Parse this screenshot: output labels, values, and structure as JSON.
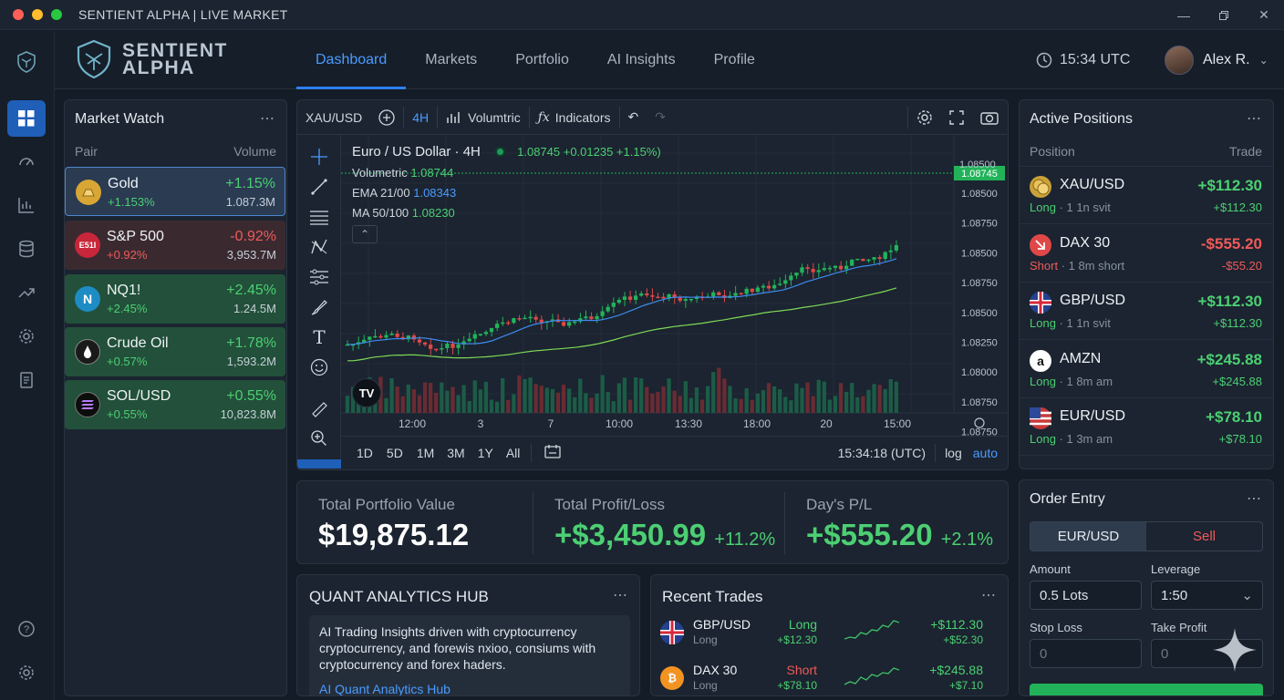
{
  "window": {
    "title": "SENTIENT ALPHA | LIVE MARKET"
  },
  "brand": {
    "line1": "SENTIENT",
    "line2": "ALPHA"
  },
  "nav": {
    "tabs": [
      "Dashboard",
      "Markets",
      "Portfolio",
      "AI Insights",
      "Profile"
    ],
    "active": "Dashboard"
  },
  "header": {
    "time": "15:34 UTC",
    "user": "Alex R."
  },
  "sidebar": {
    "icons": [
      "dashboard-icon",
      "speedometer-icon",
      "chart-bars-icon",
      "database-icon",
      "trend-icon",
      "gear-icon",
      "report-icon",
      "help-icon",
      "settings-icon"
    ]
  },
  "market_watch": {
    "title": "Market Watch",
    "col_pair": "Pair",
    "col_volume": "Volume",
    "rows": [
      {
        "name": "Gold",
        "sub": "+1.153%",
        "pct": "+1.15%",
        "vol": "1.087.3M",
        "icon": "gold-bar-icon",
        "trend": "up"
      },
      {
        "name": "S&P 500",
        "sub": "+0.92%",
        "pct": "-0.92%",
        "vol": "3,953.7M",
        "icon_text": "E51I",
        "trend": "down"
      },
      {
        "name": "NQ1!",
        "sub": "+2.45%",
        "pct": "+2.45%",
        "vol": "1.24.5M",
        "icon_text": "N",
        "trend": "up"
      },
      {
        "name": "Crude Oil",
        "sub": "+0.57%",
        "pct": "+1.78%",
        "vol": "1,593.2M",
        "icon": "oil-drop-icon",
        "trend": "up"
      },
      {
        "name": "SOL/USD",
        "sub": "+0.55%",
        "pct": "+0.55%",
        "vol": "10,823.8M",
        "icon": "solana-icon",
        "trend": "up"
      }
    ]
  },
  "chart_toolbar": {
    "symbol": "XAU/USD",
    "interval": "4H",
    "chart_style": "Volumtric",
    "indicators": "Indicators"
  },
  "chart_legend": {
    "title": "Euro / US Dollar · 4H",
    "quote": "1.08745 +0.01235 +1.15%)",
    "volumetric_label": "Volumetric",
    "volumetric_val": "1.08744",
    "ema_label": "EMA 21/00",
    "ema_val": "1.08343",
    "ma_label": "MA 50/100",
    "ma_val": "1.08230"
  },
  "chart_bottom": {
    "ranges": [
      "1D",
      "5D",
      "1M",
      "3M",
      "1Y",
      "All"
    ],
    "time": "15:34:18 (UTC)",
    "log": "log",
    "auto": "auto"
  },
  "chart_data": {
    "type": "candlestick",
    "price_axis": [
      "1.08500",
      "1.08750",
      "1.08500",
      "1.08750",
      "1.08500",
      "1.08250",
      "1.08000",
      "1.08750",
      "1.08750"
    ],
    "price_axis_top": "1.08500",
    "last_price": "1.08745",
    "x_labels": [
      "12:00",
      "3",
      "7",
      "10:00",
      "13:30",
      "18:00",
      "20",
      "15:00"
    ],
    "series": [
      {
        "name": "EMA 21/00",
        "color": "#3d8bf0"
      },
      {
        "name": "MA 50/100",
        "color": "#7fd957"
      }
    ],
    "up_color": "#22b35a",
    "down_color": "#e04848"
  },
  "stats": {
    "total_label": "Total Portfolio Value",
    "total_value": "$19,875.12",
    "pl_label": "Total Profit/Loss",
    "pl_value": "+$3,450.99",
    "pl_pct": "+11.2%",
    "day_label": "Day's P/L",
    "day_value": "+$555.20",
    "day_pct": "+2.1%"
  },
  "quant": {
    "title": "QUANT ANALYTICS HUB",
    "text": "AI Trading Insights driven with cryptocurrency cryptocurrency, and forewis nxioo, consiums with cryptocurrency and forex haders.",
    "link": "AI Quant Analytics Hub"
  },
  "recent_trades": {
    "title": "Recent Trades",
    "rows": [
      {
        "name": "GBP/USD",
        "sub": "Long",
        "side": "Long",
        "side_val": "+$12.30",
        "v1": "+$112.30",
        "v2": "+$52.30",
        "icon": "uk-flag-icon"
      },
      {
        "name": "DAX 30",
        "sub": "Long",
        "side": "Short",
        "side_val": "+$78.10",
        "v1": "+$245.88",
        "v2": "+$7.10",
        "icon_text": "₿"
      }
    ]
  },
  "active_positions": {
    "title": "Active Positions",
    "col_position": "Position",
    "col_trade": "Trade",
    "rows": [
      {
        "name": "XAU/USD",
        "side": "Long",
        "detail": "· 1 1n svit",
        "val": "+$112.30",
        "val2": "+$112.30",
        "trend": "up",
        "icon": "gold-coin-icon"
      },
      {
        "name": "DAX 30",
        "side": "Short",
        "detail": "· 1 8m short",
        "val": "-$555.20",
        "val2": "-$55.20",
        "trend": "down",
        "icon": "down-arrow-icon"
      },
      {
        "name": "GBP/USD",
        "side": "Long",
        "detail": "· 1 1n svit",
        "val": "+$112.30",
        "val2": "+$112.30",
        "trend": "up",
        "icon": "uk-flag-icon"
      },
      {
        "name": "AMZN",
        "side": "Long",
        "detail": "· 1 8m am",
        "val": "+$245.88",
        "val2": "+$245.88",
        "trend": "up",
        "icon": "amazon-icon"
      },
      {
        "name": "EUR/USD",
        "side": "Long",
        "detail": "· 1 3m am",
        "val": "+$78.10",
        "val2": "+$78.10",
        "trend": "up",
        "icon": "us-flag-icon"
      }
    ]
  },
  "order_entry": {
    "title": "Order Entry",
    "pair": "EUR/USD",
    "sell": "Sell",
    "amount_label": "Amount",
    "amount_value": "0.5 Lots",
    "leverage_label": "Leverage",
    "leverage_value": "1:50",
    "sl_label": "Stop Loss",
    "sl_placeholder": "0",
    "tp_label": "Take Profit",
    "tp_placeholder": "0"
  }
}
